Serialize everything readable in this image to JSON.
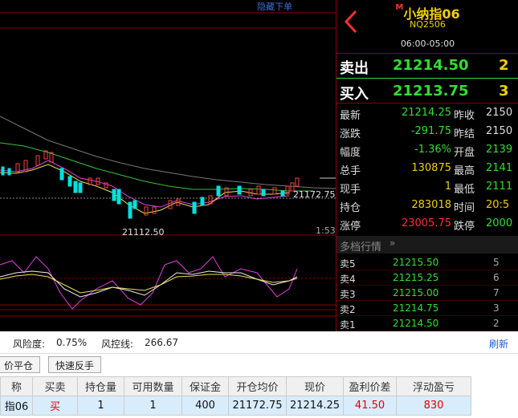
{
  "chart": {
    "hide_order_label": "隐藏下单",
    "last_price_label": "21172.75",
    "low_label": "21112.50",
    "time_label": "1:53"
  },
  "quote": {
    "name": "小纳指06",
    "mark": "M",
    "code": "NQ2506",
    "session": "06:00-05:00",
    "ask": {
      "label": "卖出",
      "price": "21214.50",
      "qty": "2"
    },
    "bid": {
      "label": "买入",
      "price": "21213.75",
      "qty": "3"
    },
    "rows": [
      {
        "l1": "最新",
        "v1": "21214.25",
        "c1": "#33dd33",
        "l2": "昨收",
        "v2": "2150",
        "c2": "#ddd"
      },
      {
        "l1": "涨跌",
        "v1": "-291.75",
        "c1": "#33dd33",
        "l2": "昨结",
        "v2": "2150",
        "c2": "#ddd"
      },
      {
        "l1": "幅度",
        "v1": "-1.36%",
        "c1": "#33dd33",
        "l2": "开盘",
        "v2": "2139",
        "c2": "#33dd33"
      },
      {
        "l1": "总手",
        "v1": "130875",
        "c1": "#f0d000",
        "l2": "最高",
        "v2": "2141",
        "c2": "#33dd33"
      },
      {
        "l1": "现手",
        "v1": "1",
        "c1": "#f0d000",
        "l2": "最低",
        "v2": "2111",
        "c2": "#33dd33"
      },
      {
        "l1": "持仓",
        "v1": "283018",
        "c1": "#f0d000",
        "l2": "时间",
        "v2": "20:5",
        "c2": "#f0d000"
      },
      {
        "l1": "涨停",
        "v1": "23005.75",
        "c1": "#ff3030",
        "l2": "跌停",
        "v2": "2000",
        "c2": "#33dd33"
      }
    ],
    "depth_title": "多档行情",
    "depth_toggle": "»",
    "depth": [
      {
        "label": "卖5",
        "price": "21215.50",
        "qty": "5"
      },
      {
        "label": "卖4",
        "price": "21215.25",
        "qty": "6"
      },
      {
        "label": "卖3",
        "price": "21215.00",
        "qty": "7"
      },
      {
        "label": "卖2",
        "price": "21214.75",
        "qty": "3"
      },
      {
        "label": "卖1",
        "price": "21214.50",
        "qty": "2"
      }
    ]
  },
  "account": {
    "risk_label": "风险度:",
    "risk_value": "0.75%",
    "line_label": "风控线:",
    "line_value": "266.67",
    "refresh_label": "刷新"
  },
  "buttons": {
    "close": "价平仓",
    "reverse": "快速反手"
  },
  "positions": {
    "headers": [
      "称",
      "买卖",
      "持仓量",
      "可用数量",
      "保证金",
      "开仓均价",
      "现价",
      "盈利价差",
      "浮动盈亏"
    ],
    "row": [
      "指06",
      "买",
      "1",
      "1",
      "400",
      "21172.75",
      "21214.25",
      "41.50",
      "830"
    ]
  }
}
